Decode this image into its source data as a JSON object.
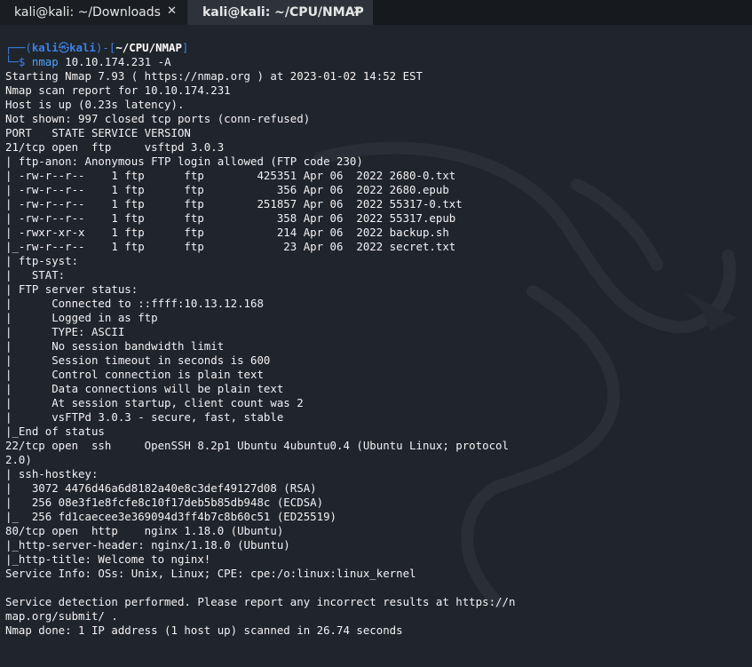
{
  "tabs": [
    {
      "label": "kali@kali: ~/Downloads",
      "close": "✕"
    },
    {
      "label": "kali@kali: ~/CPU/NMAP",
      "close": "✕"
    }
  ],
  "prompt": {
    "corner_top": "┌──(",
    "user": "kali",
    "at": "㉿",
    "host": "kali",
    "mid": ")-[",
    "path": "~/CPU/NMAP",
    "end": "]",
    "corner_bottom": "└─",
    "dollar": "$",
    "command": "nmap",
    "args": "10.10.174.231 -A"
  },
  "output": [
    "Starting Nmap 7.93 ( https://nmap.org ) at 2023-01-02 14:52 EST",
    "Nmap scan report for 10.10.174.231",
    "Host is up (0.23s latency).",
    "Not shown: 997 closed tcp ports (conn-refused)",
    "PORT   STATE SERVICE VERSION",
    "21/tcp open  ftp     vsftpd 3.0.3",
    "| ftp-anon: Anonymous FTP login allowed (FTP code 230)",
    "| -rw-r--r--    1 ftp      ftp        425351 Apr 06  2022 2680-0.txt",
    "| -rw-r--r--    1 ftp      ftp           356 Apr 06  2022 2680.epub",
    "| -rw-r--r--    1 ftp      ftp        251857 Apr 06  2022 55317-0.txt",
    "| -rw-r--r--    1 ftp      ftp           358 Apr 06  2022 55317.epub",
    "| -rwxr-xr-x    1 ftp      ftp           214 Apr 06  2022 backup.sh",
    "|_-rw-r--r--    1 ftp      ftp            23 Apr 06  2022 secret.txt",
    "| ftp-syst:",
    "|   STAT:",
    "| FTP server status:",
    "|      Connected to ::ffff:10.13.12.168",
    "|      Logged in as ftp",
    "|      TYPE: ASCII",
    "|      No session bandwidth limit",
    "|      Session timeout in seconds is 600",
    "|      Control connection is plain text",
    "|      Data connections will be plain text",
    "|      At session startup, client count was 2",
    "|      vsFTPd 3.0.3 - secure, fast, stable",
    "|_End of status",
    "22/tcp open  ssh     OpenSSH 8.2p1 Ubuntu 4ubuntu0.4 (Ubuntu Linux; protocol",
    "2.0)",
    "| ssh-hostkey:",
    "|   3072 4476d46a6d8182a40e8c3def49127d08 (RSA)",
    "|   256 08e3f1e8fcfe8c10f17deb5b85db948c (ECDSA)",
    "|_  256 fd1caecee3e369094d3ff4b7c8b60c51 (ED25519)",
    "80/tcp open  http    nginx 1.18.0 (Ubuntu)",
    "|_http-server-header: nginx/1.18.0 (Ubuntu)",
    "|_http-title: Welcome to nginx!",
    "Service Info: OSs: Unix, Linux; CPE: cpe:/o:linux:linux_kernel",
    "",
    "Service detection performed. Please report any incorrect results at https://n",
    "map.org/submit/ .",
    "Nmap done: 1 IP address (1 host up) scanned in 26.74 seconds"
  ],
  "colors": {
    "background": "#20242b",
    "prompt_blue": "#3b82e4",
    "text": "#f2f2f2"
  }
}
